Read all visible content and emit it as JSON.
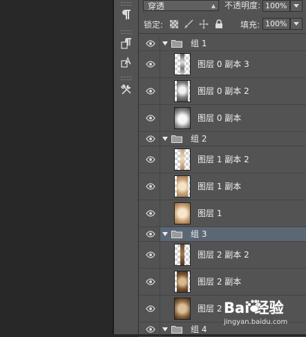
{
  "options": {
    "blend_mode": "穿透",
    "opacity_label": "不透明度:",
    "opacity_value": "100%",
    "lock_label": "锁定:",
    "fill_label": "填充:",
    "fill_value": "100%"
  },
  "toolstrip": {
    "icons": [
      "paragraph-icon",
      "paragraph-styles-icon",
      "character-styles-icon",
      "tool-presets-icon"
    ]
  },
  "layers": [
    {
      "type": "group",
      "name": "组 1",
      "expanded": true
    },
    {
      "type": "layer",
      "name": "图层 0 副本 3"
    },
    {
      "type": "layer",
      "name": "图层 0 副本 2"
    },
    {
      "type": "layer",
      "name": "图层 0 副本"
    },
    {
      "type": "group",
      "name": "组 2",
      "expanded": true
    },
    {
      "type": "layer",
      "name": "图层 1 副本 2"
    },
    {
      "type": "layer",
      "name": "图层 1 副本"
    },
    {
      "type": "layer",
      "name": "图层 1"
    },
    {
      "type": "group",
      "name": "组 3",
      "expanded": true,
      "selected": true
    },
    {
      "type": "layer",
      "name": "图层 2 副本 2"
    },
    {
      "type": "layer",
      "name": "图层 2 副本"
    },
    {
      "type": "layer",
      "name": "图层 2"
    },
    {
      "type": "group",
      "name": "组 4",
      "expanded": true
    }
  ],
  "watermark": {
    "logo_text": "Bai  经验",
    "url": "jingyan.baidu.com"
  },
  "colors": {
    "panel_bg": "#535353",
    "selected_row": "#5c6776",
    "canvas_bg": "#282828"
  }
}
